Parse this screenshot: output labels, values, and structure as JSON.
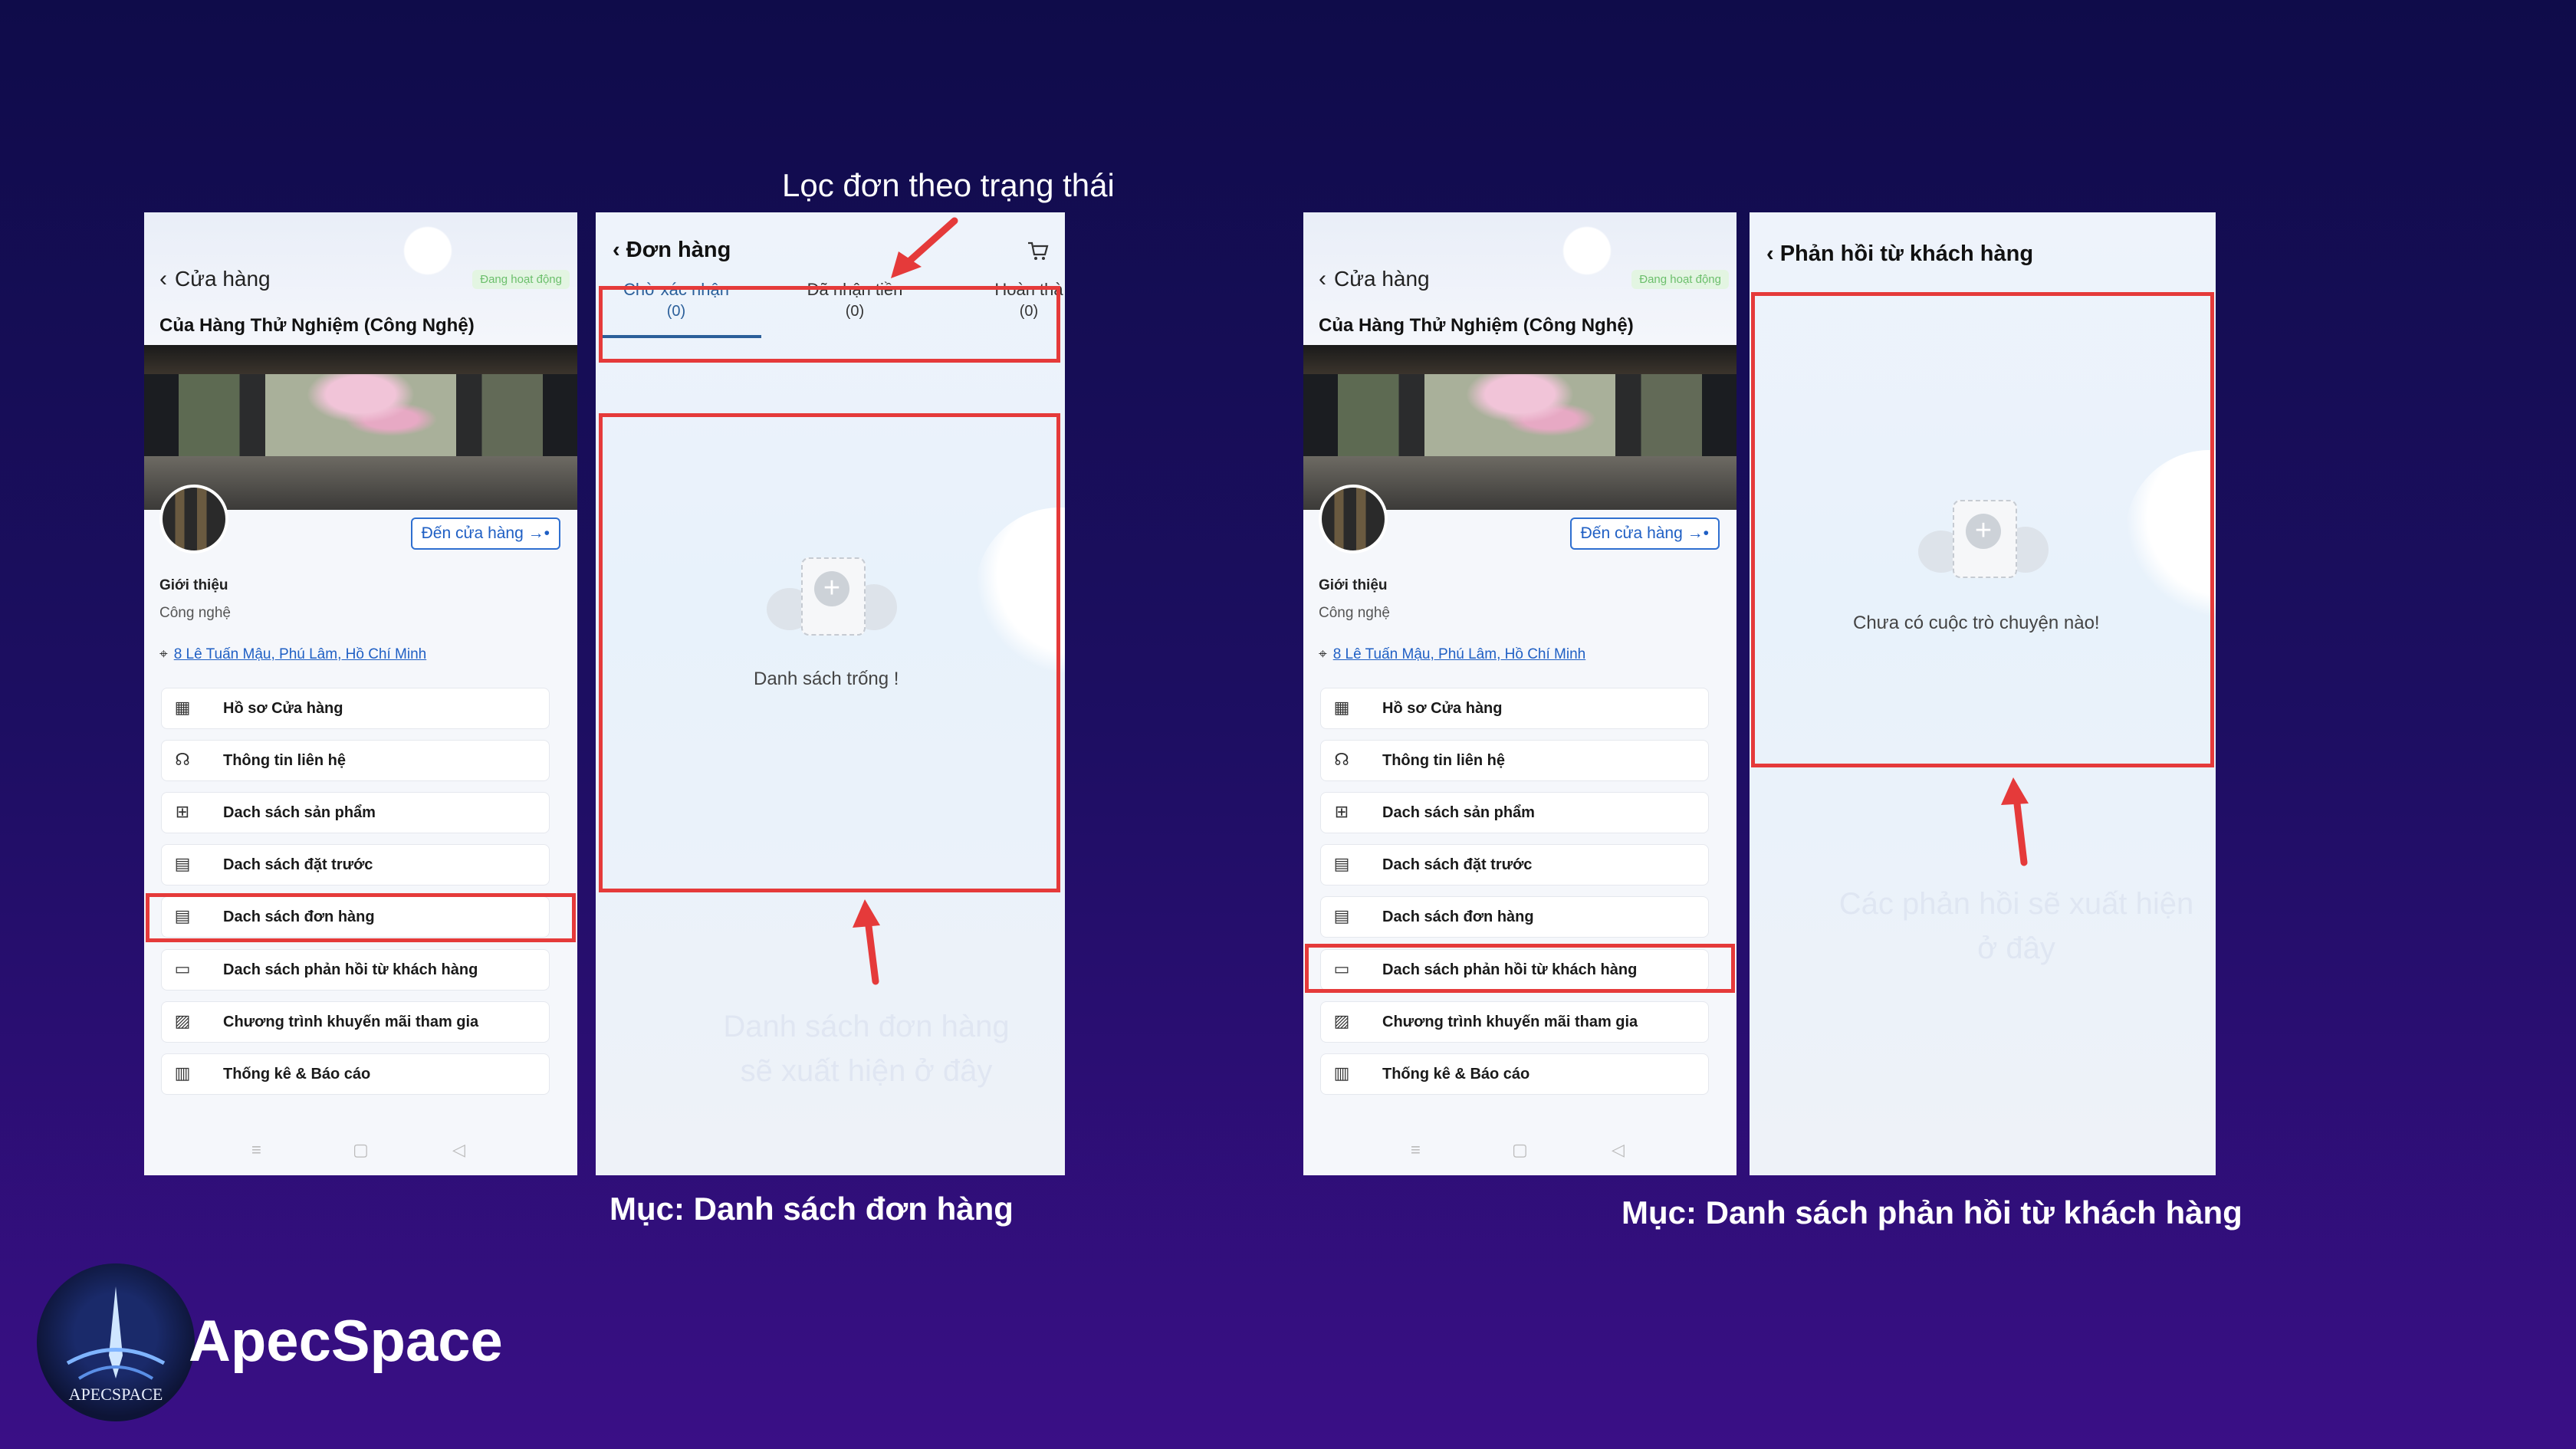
{
  "annotation": {
    "filter_note": "Lọc đơn theo trạng thái",
    "orders_placeholder": "Danh sách đơn hàng\nsẽ xuất hiện ở đây",
    "feedback_placeholder": "Các phản hồi sẽ xuất hiện\nở đây",
    "caption_orders": "Mục: Danh sách đơn hàng",
    "caption_feedback": "Mục: Danh sách phản hồi từ khách hàng"
  },
  "brand": {
    "name": "ApecSpace",
    "logo_text": "APECSPACE"
  },
  "store_screen": {
    "back_label": "Cửa hàng",
    "status": "Đang hoạt động",
    "store_name": "Của Hàng Thử Nghiệm (Công Nghệ)",
    "go_to_store": "Đến cửa hàng",
    "intro_label": "Giới thiệu",
    "intro_value": "Công nghệ",
    "address": "8 Lê Tuấn Mậu, Phú Lâm, Hồ Chí Minh",
    "menu": [
      {
        "label": "Hồ sơ Cửa hàng",
        "icon": "store-icon"
      },
      {
        "label": "Thông tin liên hệ",
        "icon": "headset-icon"
      },
      {
        "label": "Dach sách sản phẩm",
        "icon": "product-icon"
      },
      {
        "label": "Dach sách đặt trước",
        "icon": "preorder-icon"
      },
      {
        "label": "Dach sách đơn hàng",
        "icon": "order-icon"
      },
      {
        "label": "Dach sách phản hồi từ khách hàng",
        "icon": "chat-icon"
      },
      {
        "label": "Chương trình khuyến mãi tham gia",
        "icon": "ticket-icon"
      },
      {
        "label": "Thống kê & Báo cáo",
        "icon": "chart-icon"
      }
    ]
  },
  "orders_screen": {
    "title": "Đơn hàng",
    "tabs": [
      {
        "label": "Chờ xác nhận",
        "count": "(0)"
      },
      {
        "label": "Đã nhận tiền",
        "count": "(0)"
      },
      {
        "label": "Hoàn thà",
        "count": "(0)"
      }
    ],
    "empty": "Danh sách trống !"
  },
  "feedback_screen": {
    "title": "Phản hồi từ khách hàng",
    "empty": "Chưa có cuộc trò chuyện nào!"
  },
  "colors": {
    "highlight": "#e53a3a",
    "accent": "#2b5f9a",
    "link": "#1f5fc4"
  }
}
